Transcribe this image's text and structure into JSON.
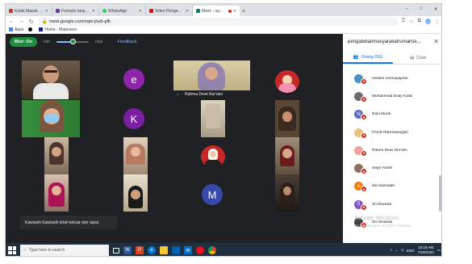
{
  "browser": {
    "tabs": [
      {
        "title": "Kotak Masuk (142) - aniea@...",
        "color": "#d93025",
        "active": false
      },
      {
        "title": "Formulir tanpa judul - Google ...",
        "color": "#673ab7",
        "active": false
      },
      {
        "title": "WhatsApp",
        "color": "#25d366",
        "active": false
      },
      {
        "title": "Video Pengenalan Arsitektur U...",
        "color": "#ff0000",
        "active": false
      },
      {
        "title": "Meet – xqm-jheb-gfb",
        "color": "#00897b",
        "active": true
      }
    ],
    "new_tab": "+",
    "window_controls": {
      "minimize": "–",
      "maximize": "□",
      "close": "✕"
    },
    "url": "meet.google.com/xqm-jheb-gfb",
    "bookmarks": [
      {
        "label": "Apps",
        "color": "#4285f4"
      },
      {
        "label": "",
        "color": "#000000"
      },
      {
        "label": "Home - Mateneeo",
        "color": "#1a237e"
      }
    ]
  },
  "meet": {
    "blur_button": "Blur: On",
    "slider_min": "min",
    "slider_max": "max",
    "slider_level": 0.5,
    "feedback": "Feedback",
    "tiles": {
      "e_letter": "e",
      "k_letter": "K",
      "m_letter": "M",
      "rahma_name": "Rahma Dewi Nur'aini"
    },
    "toast": "Kawiasih Kawiasih telah keluar dari rapat"
  },
  "panel": {
    "title": "pengabdianmasyarakatrumahse...",
    "close": "✕",
    "tab_people": "Orang (56)",
    "tab_chat": "Chat",
    "people": [
      {
        "name": "meliani nurmayaputri",
        "avatar": "",
        "color": "#4a90c2"
      },
      {
        "name": "Mohammad Dody Karbi",
        "avatar": "",
        "color": "#6d6d6d"
      },
      {
        "name": "Nani Murta",
        "avatar": "N",
        "color": "#5c6bc0"
      },
      {
        "name": "PAUD Rahmaningsih",
        "avatar": "",
        "color": "#e8c27b"
      },
      {
        "name": "Rahna Dewi Nur'aini",
        "avatar": "",
        "color": "#f0a0a0"
      },
      {
        "name": "Septi Yanthi",
        "avatar": "",
        "color": "#8d6e63"
      },
      {
        "name": "siti chamidah",
        "avatar": "s",
        "color": "#f57c00"
      },
      {
        "name": "Sri Ekowati",
        "avatar": "S",
        "color": "#7e57c2"
      },
      {
        "name": "Sri mirawati",
        "avatar": "",
        "color": "#444444"
      }
    ],
    "watermark": "Activate Windows",
    "watermark_sub": "Go to Settings to activate Windows."
  },
  "taskbar": {
    "search_placeholder": "Type here to search",
    "clock_time": "10:19 AM",
    "clock_date": "7/18/2020",
    "lang": "ENG"
  }
}
